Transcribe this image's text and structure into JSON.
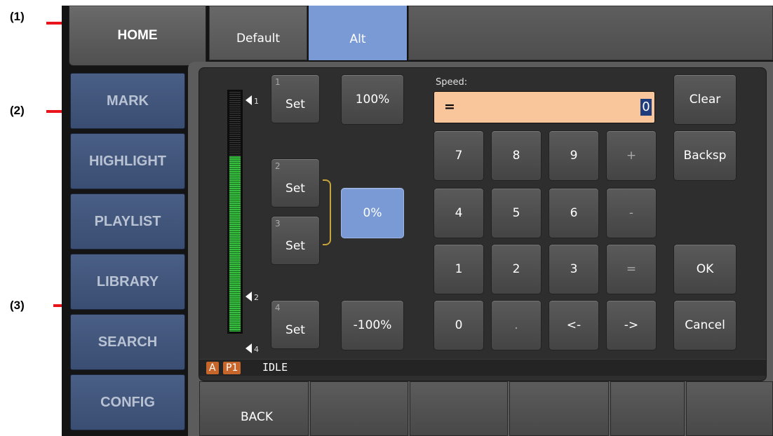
{
  "callouts": {
    "c1": "(1)",
    "c2": "(2)",
    "c3": "(3)"
  },
  "tabs": {
    "home": "HOME",
    "default": "Default",
    "alt": "Alt"
  },
  "sidebar": {
    "items": [
      {
        "label": "MARK"
      },
      {
        "label": "HIGHLIGHT"
      },
      {
        "label": "PLAYLIST"
      },
      {
        "label": "LIBRARY"
      },
      {
        "label": "SEARCH"
      },
      {
        "label": "CONFIG"
      }
    ]
  },
  "set_buttons": [
    {
      "num": "1",
      "label": "Set"
    },
    {
      "num": "2",
      "label": "Set"
    },
    {
      "num": "3",
      "label": "Set"
    },
    {
      "num": "4",
      "label": "Set"
    }
  ],
  "preset_buttons": {
    "p100": "100%",
    "p0": "0%",
    "pm100": "-100%"
  },
  "meter_markers": {
    "m1": "1",
    "m2": "2",
    "m4": "4"
  },
  "speed": {
    "label": "Speed:",
    "value": "=",
    "cursor": "0"
  },
  "keypad": {
    "row1": [
      "7",
      "8",
      "9",
      "+"
    ],
    "row2": [
      "4",
      "5",
      "6",
      "-"
    ],
    "row3": [
      "1",
      "2",
      "3",
      "="
    ],
    "row4": [
      "0",
      ".",
      "<-",
      "->"
    ]
  },
  "actions": {
    "clear": "Clear",
    "backsp": "Backsp",
    "ok": "OK",
    "cancel": "Cancel"
  },
  "status": {
    "channel": "A",
    "player": "P1",
    "state": "IDLE"
  },
  "bottom": {
    "back": "BACK"
  },
  "colors": {
    "accent_blue": "#7a9ad6",
    "speed_field": "#f8c69a",
    "meter_green": "#37c03f",
    "badge": "#c6662a",
    "callout_line": "#e8141a"
  }
}
